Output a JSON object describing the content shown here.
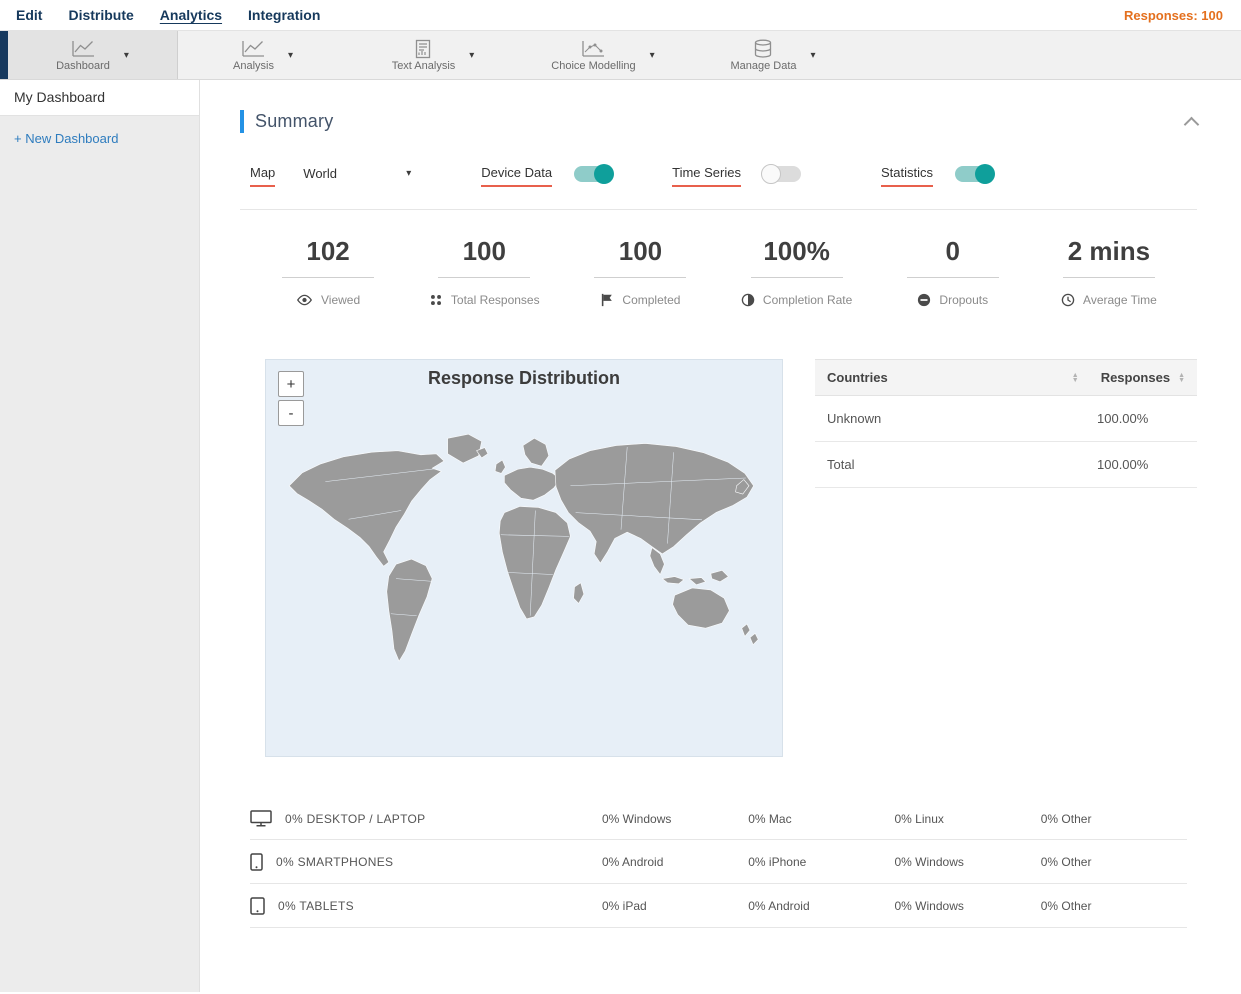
{
  "topnav": {
    "items": [
      {
        "label": "Edit"
      },
      {
        "label": "Distribute"
      },
      {
        "label": "Analytics"
      },
      {
        "label": "Integration"
      }
    ],
    "responses": "Responses: 100"
  },
  "toolbar": {
    "items": [
      {
        "label": "Dashboard",
        "icon": "line-chart-icon"
      },
      {
        "label": "Analysis",
        "icon": "line-chart-icon"
      },
      {
        "label": "Text Analysis",
        "icon": "document-chart-icon"
      },
      {
        "label": "Choice Modelling",
        "icon": "scatter-chart-icon"
      },
      {
        "label": "Manage Data",
        "icon": "database-icon"
      }
    ]
  },
  "sidebar": {
    "my_dashboard": "My Dashboard",
    "new_dashboard": "+ New Dashboard"
  },
  "summary": {
    "title": "Summary",
    "controls": {
      "map_label": "Map",
      "map_value": "World",
      "device_data_label": "Device Data",
      "device_data_on": true,
      "time_series_label": "Time Series",
      "time_series_on": false,
      "statistics_label": "Statistics",
      "statistics_on": true
    },
    "stats": [
      {
        "value": "102",
        "label": "Viewed",
        "icon": "eye-icon"
      },
      {
        "value": "100",
        "label": "Total Responses",
        "icon": "dots-grid-icon"
      },
      {
        "value": "100",
        "label": "Completed",
        "icon": "flag-icon"
      },
      {
        "value": "100%",
        "label": "Completion Rate",
        "icon": "half-circle-icon"
      },
      {
        "value": "0",
        "label": "Dropouts",
        "icon": "minus-circle-icon"
      },
      {
        "value": "2 mins",
        "label": "Average Time",
        "icon": "clock-icon"
      }
    ],
    "map": {
      "title": "Response Distribution",
      "zoom_in": "+",
      "zoom_out": "-"
    },
    "countries_table": {
      "country_header": "Countries",
      "responses_header": "Responses",
      "rows": [
        {
          "country": "Unknown",
          "responses": "100.00%"
        },
        {
          "country": "Total",
          "responses": "100.00%"
        }
      ]
    },
    "devices": [
      {
        "icon": "desktop-icon",
        "label": "0% DESKTOP / LAPTOP",
        "cols": [
          "0% Windows",
          "0% Mac",
          "0% Linux",
          "0% Other"
        ]
      },
      {
        "icon": "smartphone-icon",
        "label": "0% SMARTPHONES",
        "cols": [
          "0% Android",
          "0% iPhone",
          "0% Windows",
          "0% Other"
        ]
      },
      {
        "icon": "tablet-icon",
        "label": "0% TABLETS",
        "cols": [
          "0% iPad",
          "0% Android",
          "0% Windows",
          "0% Other"
        ]
      }
    ]
  },
  "colors": {
    "accent_blue": "#2492e5",
    "nav_navy": "#16395c",
    "responses_orange": "#e4701e",
    "underline_red": "#e8604c",
    "toggle_teal": "#0f9f9b",
    "link_blue": "#2e7cbe",
    "map_bg": "#e7eff7",
    "map_land": "#9b9b9b"
  }
}
